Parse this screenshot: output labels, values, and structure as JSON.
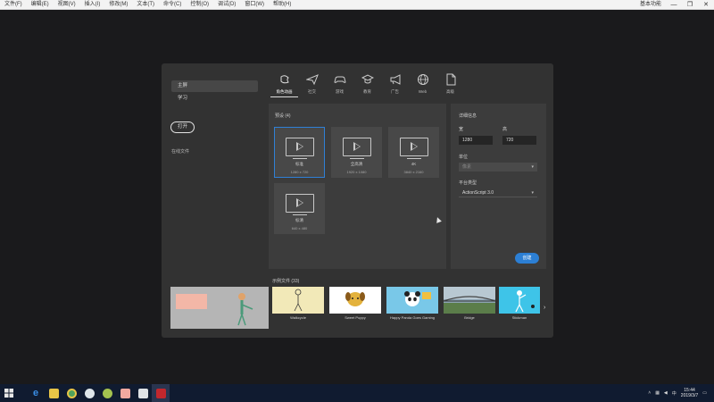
{
  "menubar": {
    "items": [
      "文件(F)",
      "编辑(E)",
      "视图(V)",
      "插入(I)",
      "修改(M)",
      "文本(T)",
      "命令(C)",
      "控制(O)",
      "调试(D)",
      "窗口(W)",
      "帮助(H)"
    ],
    "right_label": "基本功能",
    "win_minimize": "—",
    "win_restore": "❐",
    "win_close": "✕"
  },
  "sidebar": {
    "items": [
      "主屏",
      "学习"
    ],
    "open_button": "打开",
    "recent_label": "在线文件"
  },
  "tabs": [
    {
      "label": "角色动画",
      "icon": "character-animation-icon",
      "active": true
    },
    {
      "label": "社交",
      "icon": "paper-plane-icon",
      "active": false
    },
    {
      "label": "游戏",
      "icon": "gamepad-icon",
      "active": false
    },
    {
      "label": "教育",
      "icon": "graduation-cap-icon",
      "active": false
    },
    {
      "label": "广告",
      "icon": "megaphone-icon",
      "active": false
    },
    {
      "label": "Web",
      "icon": "globe-icon",
      "active": false
    },
    {
      "label": "高级",
      "icon": "document-icon",
      "active": false
    }
  ],
  "presets": {
    "title": "预设 (4)",
    "cards": [
      {
        "name": "标准",
        "size": "1280 x 720",
        "selected": true
      },
      {
        "name": "全高清",
        "size": "1920 x 1080",
        "selected": false
      },
      {
        "name": "4K",
        "size": "3840 x 2160",
        "selected": false
      },
      {
        "name": "标清",
        "size": "640 x 480",
        "selected": false
      }
    ]
  },
  "details": {
    "title": "详细信息",
    "width_label": "宽",
    "width_value": "1280",
    "height_label": "高",
    "height_value": "720",
    "units_label": "单位",
    "units_value": "像素",
    "platform_label": "平台类型",
    "platform_value": "ActionScript 3.0",
    "create_button": "创建"
  },
  "recent": {
    "title": "示例文件 (33)",
    "thumbnails": [
      {
        "name": "Walkcycle",
        "color": "#f2e9b8"
      },
      {
        "name": "Sweet Puppy",
        "color": "#ffffff"
      },
      {
        "name": "Happy Panda Goes Gaming",
        "color": "#79c8e8"
      },
      {
        "name": "Bridge",
        "color": "#8da4b3"
      },
      {
        "name": "Stickman",
        "color": "#3ec4e8"
      }
    ]
  },
  "taskbar": {
    "time": "15:44",
    "date": "2019/3/7",
    "lang": "中"
  }
}
